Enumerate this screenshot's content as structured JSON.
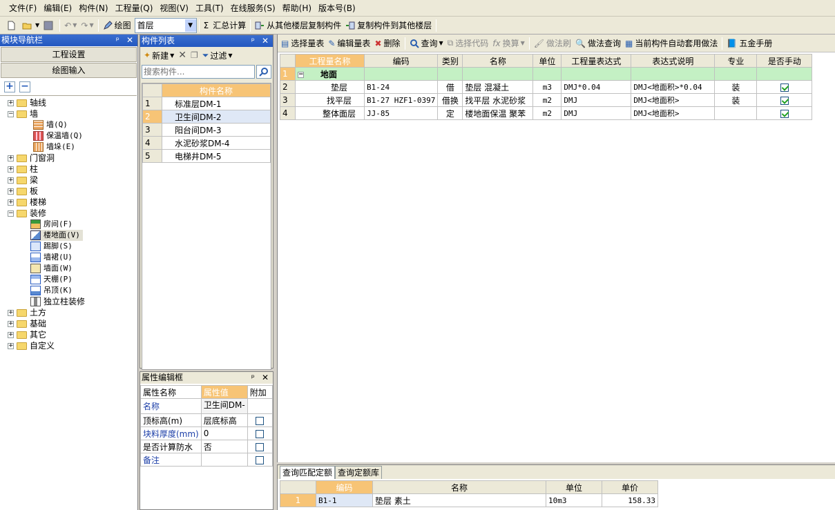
{
  "menu": [
    "文件(F)",
    "编辑(E)",
    "构件(N)",
    "工程量(Q)",
    "视图(V)",
    "工具(T)",
    "在线服务(S)",
    "帮助(H)",
    "版本号(B)"
  ],
  "toolbar1": {
    "draw": "绘图",
    "floor": "首层",
    "sum": "汇总计算",
    "copy_from": "从其他楼层复制构件",
    "copy_to": "复制构件到其他楼层"
  },
  "nav": {
    "title": "模块导航栏",
    "btn_project": "工程设置",
    "btn_draw": "绘图输入",
    "tree": {
      "axis": "轴线",
      "wall": "墙",
      "wall_children": [
        "墙(Q)",
        "保温墙(Q)",
        "墙垛(E)"
      ],
      "doorwin": "门窗洞",
      "column": "柱",
      "beam": "梁",
      "slab": "板",
      "stair": "楼梯",
      "decor": "装修",
      "decor_children": [
        "房间(F)",
        "楼地面(V)",
        "踢脚(S)",
        "墙裙(U)",
        "墙面(W)",
        "天棚(P)",
        "吊顶(K)",
        "独立柱装修"
      ],
      "earth": "土方",
      "foundation": "基础",
      "other": "其它",
      "custom": "自定义"
    }
  },
  "complist": {
    "title": "构件列表",
    "new": "新建",
    "filter": "过滤",
    "search_placeholder": "搜索构件...",
    "col_name": "构件名称",
    "rows": [
      {
        "n": "1",
        "name": "标准层DM-1"
      },
      {
        "n": "2",
        "name": "卫生间DM-2"
      },
      {
        "n": "3",
        "name": "阳台间DM-3"
      },
      {
        "n": "4",
        "name": "水泥砂浆DM-4"
      },
      {
        "n": "5",
        "name": "电梯井DM-5"
      }
    ]
  },
  "props": {
    "title": "属性编辑框",
    "h_name": "属性名称",
    "h_val": "属性值",
    "h_add": "附加",
    "rows": [
      {
        "name": "名称",
        "val": "卫生间DM-",
        "blue": true,
        "chk": null
      },
      {
        "name": "顶标高(m)",
        "val": "层底标高",
        "blue": false,
        "chk": false
      },
      {
        "name": "块料厚度(mm)",
        "val": "0",
        "blue": true,
        "chk": false
      },
      {
        "name": "是否计算防水",
        "val": "否",
        "blue": false,
        "chk": false
      },
      {
        "name": "备注",
        "val": "",
        "blue": true,
        "chk": false
      }
    ]
  },
  "toolbar2": {
    "select_table": "选择量表",
    "edit_table": "编辑量表",
    "delete": "删除",
    "query": "查询",
    "select_code": "选择代码",
    "convert": "换算",
    "brush": "做法刷",
    "method_query": "做法查询",
    "auto_apply": "当前构件自动套用做法",
    "hardware": "五金手册"
  },
  "qty": {
    "headers": [
      "工程量名称",
      "编码",
      "类别",
      "名称",
      "单位",
      "工程量表达式",
      "表达式说明",
      "专业",
      "是否手动"
    ],
    "group": "地面",
    "rows": [
      {
        "n": "2",
        "qname": "垫层",
        "code": "B1-24",
        "cat": "借",
        "name": "垫层 混凝土",
        "unit": "m3",
        "expr": "DMJ*0.04",
        "desc": "DMJ<地面积>*0.04",
        "spec": "装",
        "manual": true
      },
      {
        "n": "3",
        "qname": "找平层",
        "code": "B1-27 HZF1-0397",
        "cat": "借换",
        "name": "找平层 水泥砂浆",
        "unit": "m2",
        "expr": "DMJ",
        "desc": "DMJ<地面积>",
        "spec": "装",
        "manual": true
      },
      {
        "n": "4",
        "qname": "整体面层",
        "code": "JJ-85",
        "cat": "定",
        "name": "楼地面保温  聚苯",
        "unit": "m2",
        "expr": "DMJ",
        "desc": "DMJ<地面积>",
        "spec": "",
        "manual": true
      }
    ]
  },
  "bottom": {
    "tab1": "查询匹配定额",
    "tab2": "查询定额库",
    "headers": [
      "编码",
      "名称",
      "单位",
      "单价"
    ],
    "rows": [
      {
        "n": "1",
        "code": "B1-1",
        "name": "垫层 素土",
        "unit": "10m3",
        "price": "158.33"
      }
    ]
  }
}
